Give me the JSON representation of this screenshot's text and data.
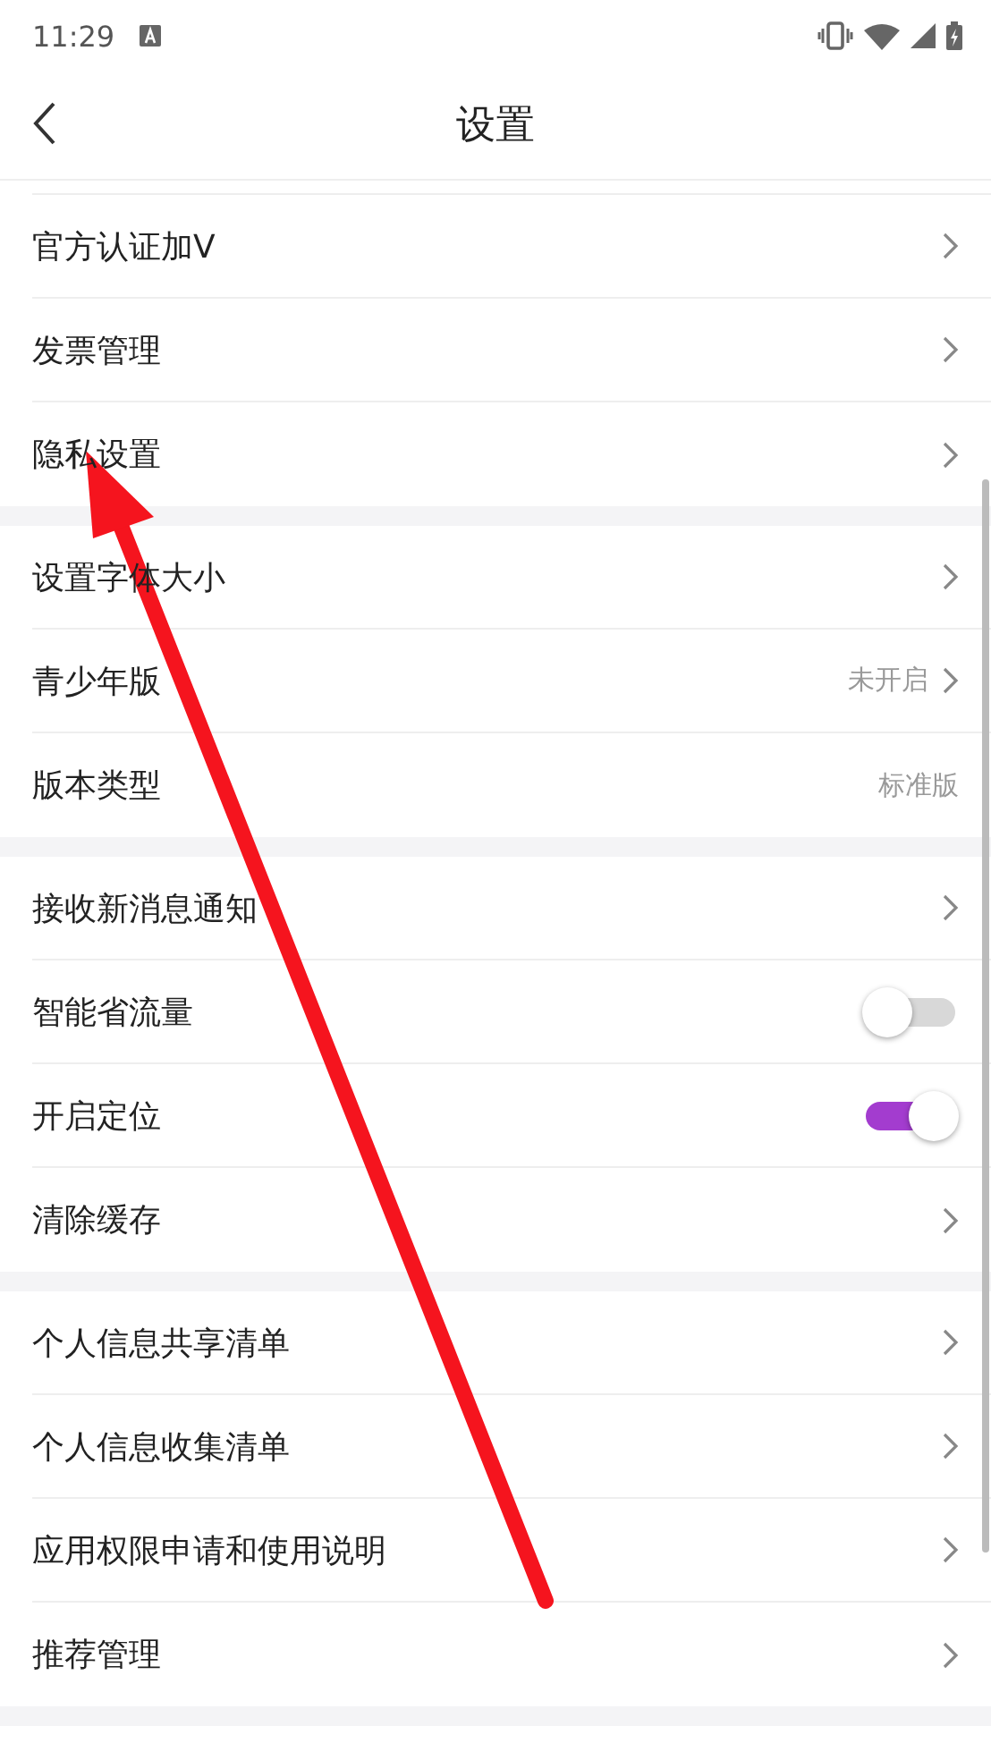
{
  "status_bar": {
    "time": "11:29"
  },
  "header": {
    "title": "设置"
  },
  "groups": [
    {
      "rows": [
        {
          "kind": "link",
          "label": "官方认证加V"
        },
        {
          "kind": "link",
          "label": "发票管理"
        },
        {
          "kind": "link",
          "label": "隐私设置"
        }
      ]
    },
    {
      "rows": [
        {
          "kind": "link",
          "label": "设置字体大小"
        },
        {
          "kind": "link",
          "label": "青少年版",
          "value": "未开启"
        },
        {
          "kind": "value",
          "label": "版本类型",
          "value": "标准版"
        }
      ]
    },
    {
      "rows": [
        {
          "kind": "link",
          "label": "接收新消息通知"
        },
        {
          "kind": "toggle",
          "label": "智能省流量",
          "on": false
        },
        {
          "kind": "toggle",
          "label": "开启定位",
          "on": true
        },
        {
          "kind": "link",
          "label": "清除缓存"
        }
      ]
    },
    {
      "rows": [
        {
          "kind": "link",
          "label": "个人信息共享清单"
        },
        {
          "kind": "link",
          "label": "个人信息收集清单"
        },
        {
          "kind": "link",
          "label": "应用权限申请和使用说明"
        },
        {
          "kind": "link",
          "label": "推荐管理"
        }
      ]
    }
  ]
}
